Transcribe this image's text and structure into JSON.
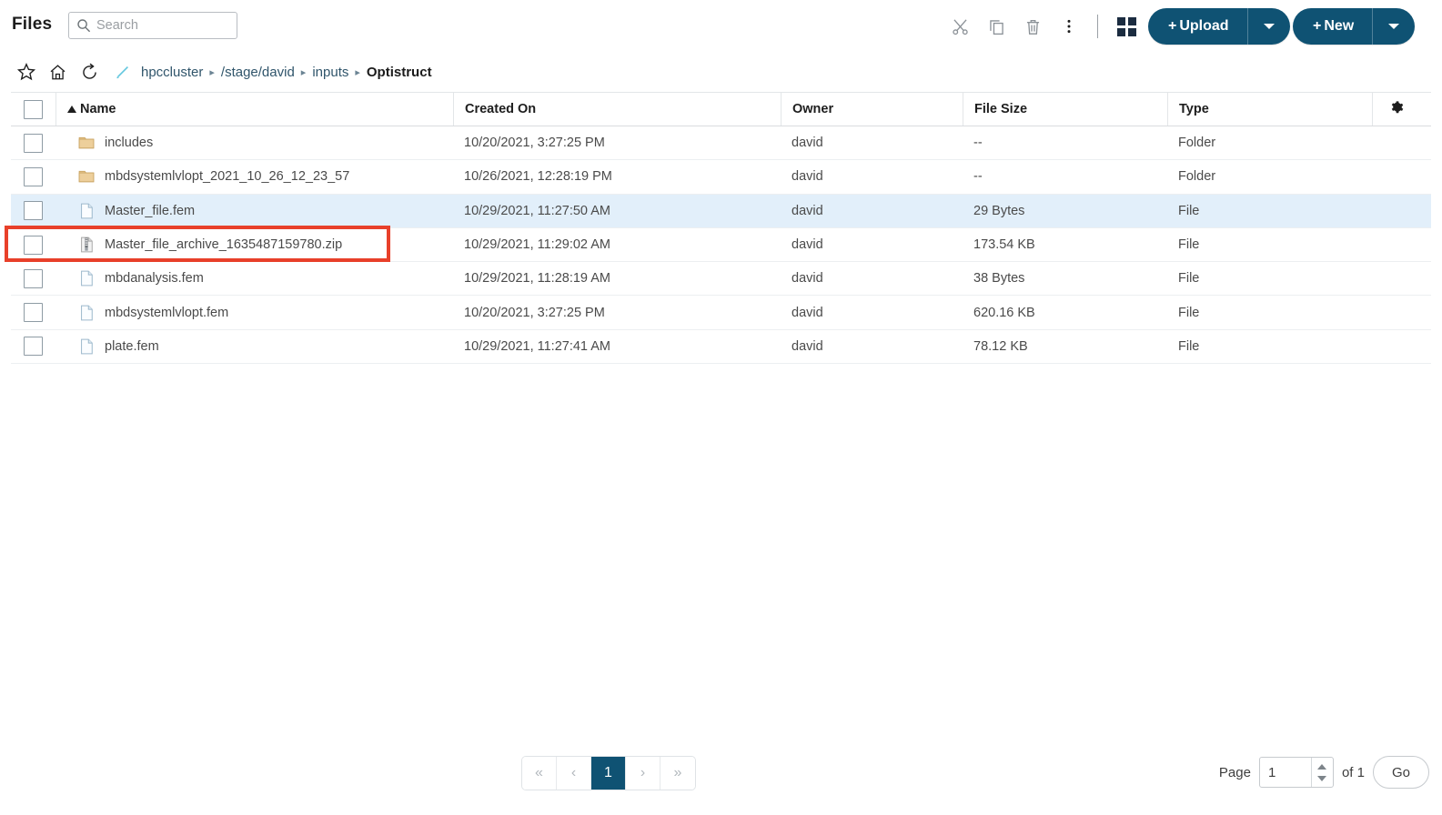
{
  "header": {
    "title": "Files",
    "search": {
      "value": "",
      "placeholder": "Search"
    },
    "tool_icons": [
      {
        "name": "cut-icon",
        "label": "Cut"
      },
      {
        "name": "copy-icon",
        "label": "Copy"
      },
      {
        "name": "trash-icon",
        "label": "Delete"
      },
      {
        "name": "more-vertical-icon",
        "label": "More"
      }
    ],
    "view_toggle": {
      "name": "grid-view-icon",
      "label": "Grid view"
    },
    "upload_button": {
      "label": "Upload",
      "plus": "+",
      "caret": "▾"
    },
    "new_button": {
      "label": "New",
      "plus": "+",
      "caret": "▾"
    },
    "accent_color": "#0f5273"
  },
  "breadcrumb_bar": {
    "icons": [
      {
        "name": "favorite-icon",
        "label": "Favorite"
      },
      {
        "name": "home-icon",
        "label": "Home"
      },
      {
        "name": "refresh-icon",
        "label": "Refresh"
      },
      {
        "name": "rename-pencil-icon",
        "label": "Rename",
        "color": "#63c7de"
      }
    ],
    "crumbs": [
      {
        "label": "hpccluster",
        "current": false
      },
      {
        "label": "/stage/david",
        "current": false
      },
      {
        "label": "inputs",
        "current": false
      },
      {
        "label": "Optistruct",
        "current": true
      }
    ],
    "separator": "▸"
  },
  "table": {
    "columns": [
      {
        "key": "name",
        "label": "Name",
        "sorted": "asc"
      },
      {
        "key": "created_on",
        "label": "Created On"
      },
      {
        "key": "owner",
        "label": "Owner"
      },
      {
        "key": "file_size",
        "label": "File Size"
      },
      {
        "key": "type",
        "label": "Type"
      }
    ],
    "settings_icon": "gear-icon",
    "rows": [
      {
        "name": "includes",
        "icon": "folder-icon",
        "created_on": "10/20/2021, 3:27:25 PM",
        "owner": "david",
        "file_size": "--",
        "type": "Folder",
        "selected": false
      },
      {
        "name": "mbdsystemlvlopt_2021_10_26_12_23_57",
        "icon": "folder-icon",
        "created_on": "10/26/2021, 12:28:19 PM",
        "owner": "david",
        "file_size": "--",
        "type": "Folder",
        "selected": false
      },
      {
        "name": "Master_file.fem",
        "icon": "file-icon",
        "created_on": "10/29/2021, 11:27:50 AM",
        "owner": "david",
        "file_size": "29 Bytes",
        "type": "File",
        "selected": true
      },
      {
        "name": "Master_file_archive_1635487159780.zip",
        "icon": "zip-icon",
        "created_on": "10/29/2021, 11:29:02 AM",
        "owner": "david",
        "file_size": "173.54 KB",
        "type": "File",
        "selected": false
      },
      {
        "name": "mbdanalysis.fem",
        "icon": "file-icon",
        "created_on": "10/29/2021, 11:28:19 AM",
        "owner": "david",
        "file_size": "38 Bytes",
        "type": "File",
        "selected": false
      },
      {
        "name": "mbdsystemlvlopt.fem",
        "icon": "file-icon",
        "created_on": "10/20/2021, 3:27:25 PM",
        "owner": "david",
        "file_size": "620.16 KB",
        "type": "File",
        "selected": false
      },
      {
        "name": "plate.fem",
        "icon": "file-icon",
        "created_on": "10/29/2021, 11:27:41 AM",
        "owner": "david",
        "file_size": "78.12 KB",
        "type": "File",
        "selected": false
      }
    ]
  },
  "annotation": {
    "name": "highlight-box",
    "target_row": "Master_file_archive_1635487159780.zip",
    "color": "#e8402a"
  },
  "footer": {
    "pagination": {
      "first": "«",
      "prev": "‹",
      "pages": [
        "1"
      ],
      "active_page": "1",
      "next": "›",
      "last": "»"
    },
    "page_label": "Page",
    "page_value": "1",
    "of_label": "of 1",
    "go_label": "Go"
  }
}
